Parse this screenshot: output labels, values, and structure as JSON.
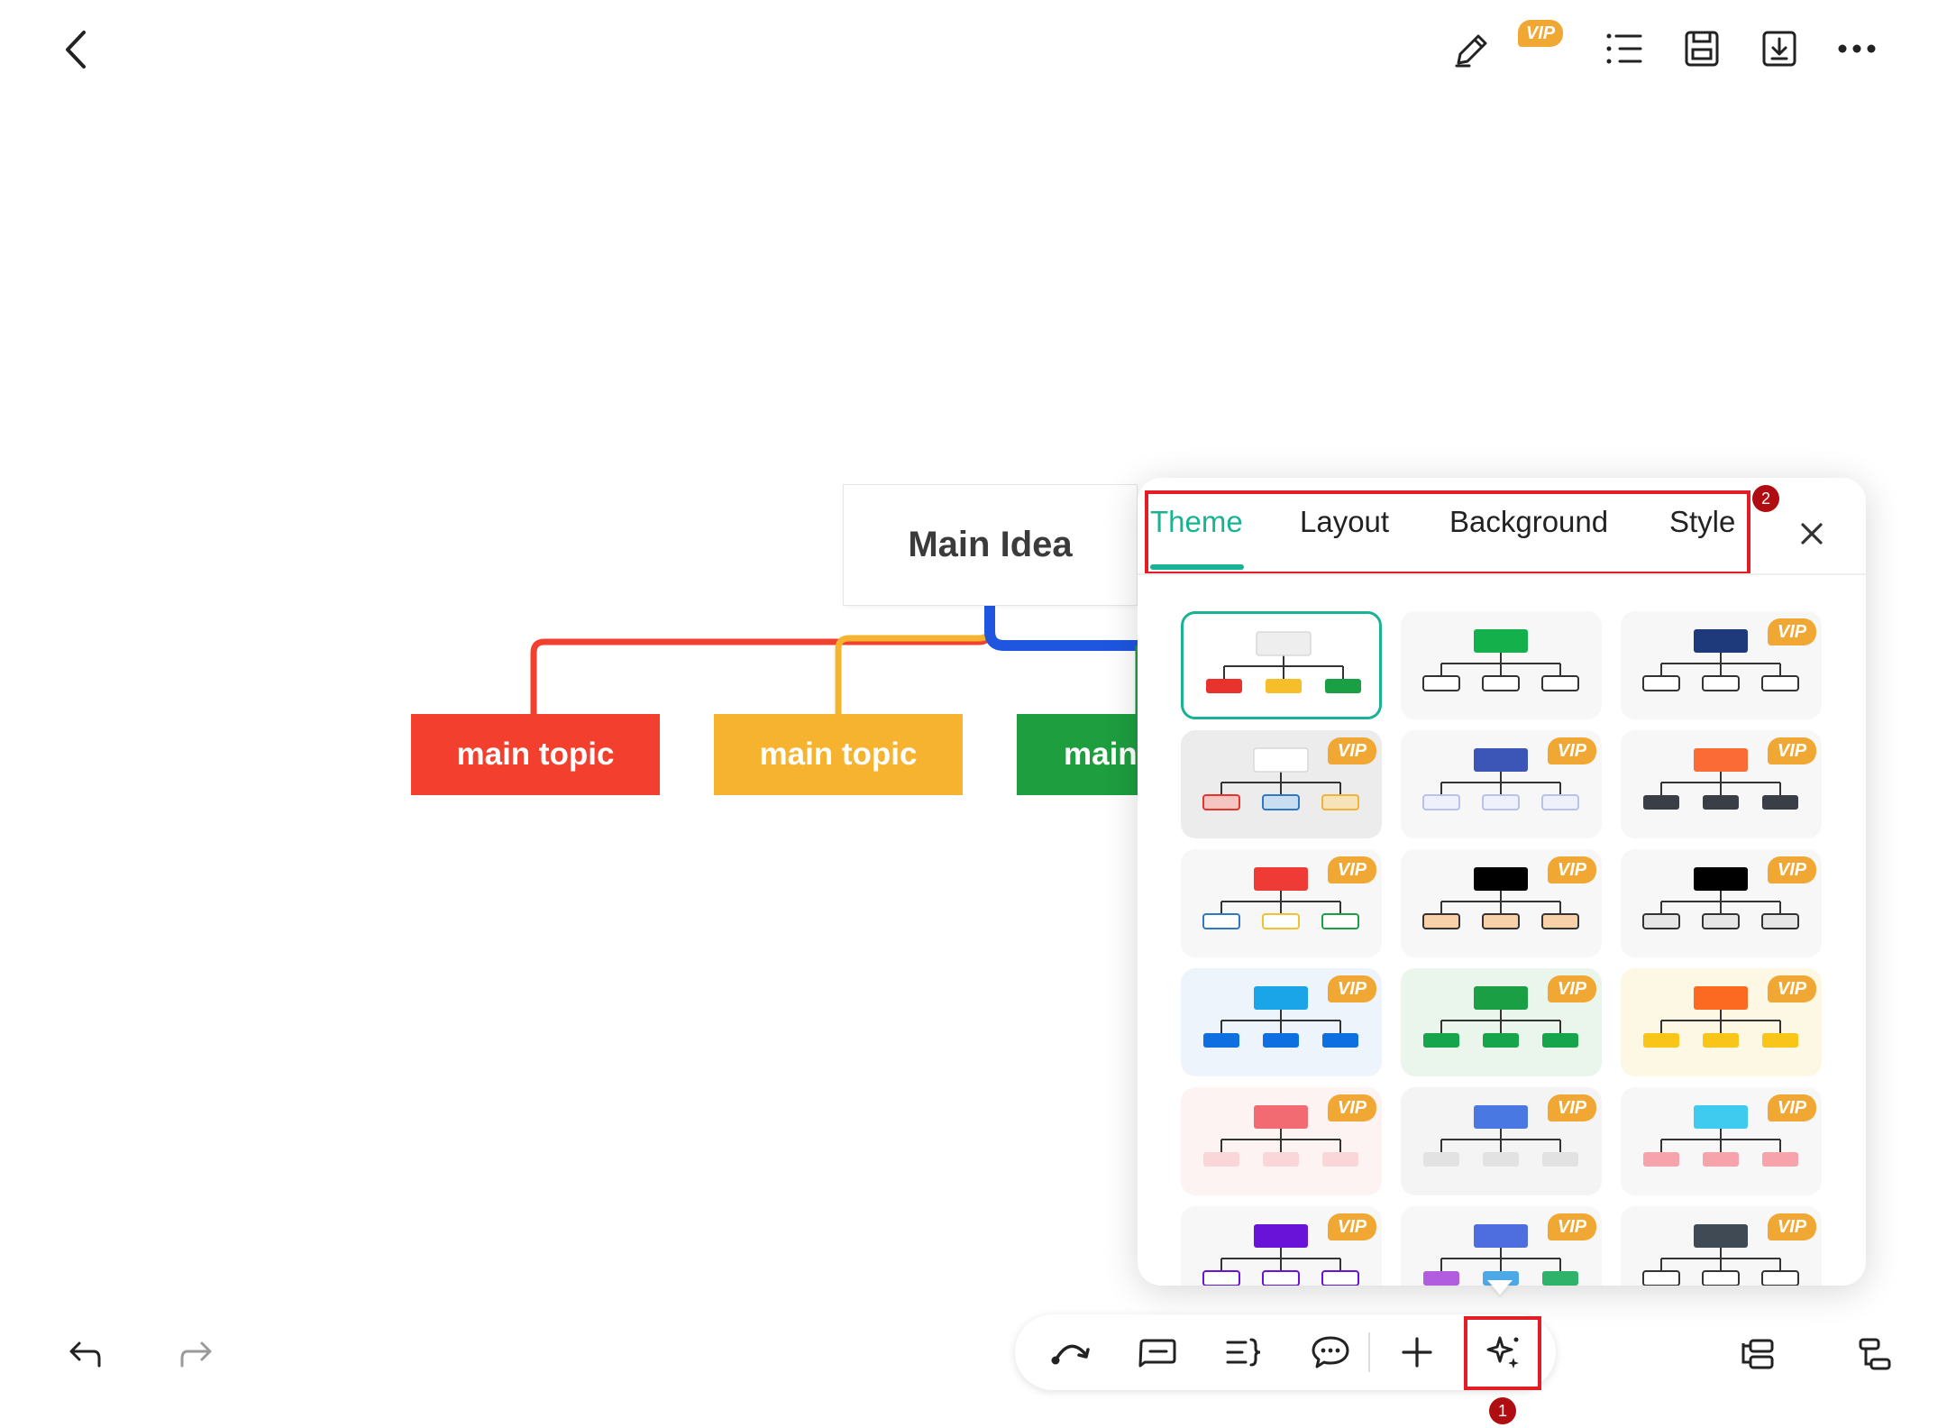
{
  "top_bar": {
    "vip_label": "VIP",
    "icons": [
      "back-icon",
      "pen-icon",
      "outline-list-icon",
      "save-icon",
      "download-icon",
      "more-icon"
    ]
  },
  "canvas": {
    "main_idea": "Main Idea",
    "topics": [
      {
        "label": "main topic",
        "color": "#f33f2e"
      },
      {
        "label": "main topic",
        "color": "#f5b32f"
      },
      {
        "label": "main",
        "color": "#1e9e3f"
      }
    ],
    "connector_colors": [
      "#f33f2e",
      "#f5b32f",
      "#1e56e0"
    ]
  },
  "panel": {
    "tabs": [
      {
        "label": "Theme",
        "active": true
      },
      {
        "label": "Layout",
        "active": false
      },
      {
        "label": "Background",
        "active": false
      },
      {
        "label": "Style",
        "active": false
      }
    ],
    "badge_tabs": "2",
    "accent_color": "#19b394",
    "themes": [
      {
        "vip": false,
        "selected": true,
        "bg": "#ffffff",
        "root": "#eeeeee",
        "children": [
          "#e8332c",
          "#f5be2a",
          "#1a9f45"
        ],
        "child_style": "fill"
      },
      {
        "vip": false,
        "bg": "#f7f7f7",
        "root": "#13b04b",
        "children": [
          "#ffffff",
          "#ffffff",
          "#ffffff"
        ],
        "child_style": "outline-dark"
      },
      {
        "vip": true,
        "bg": "#f7f7f7",
        "root": "#1e3a7a",
        "children": [
          "#ffffff",
          "#ffffff",
          "#ffffff"
        ],
        "child_style": "outline-dark"
      },
      {
        "vip": true,
        "bg": "#ececec",
        "root": "#ffffff",
        "children": [
          "#f5c5c2",
          "#c9def1",
          "#f7e3b8"
        ],
        "child_style": "outline-color",
        "outline": [
          "#e8332c",
          "#2f78c4",
          "#f0b23a"
        ]
      },
      {
        "vip": true,
        "bg": "#f7f7f7",
        "root": "#3c56b8",
        "children": [
          "#eef0fb",
          "#eef0fb",
          "#eef0fb"
        ],
        "child_style": "outline-light"
      },
      {
        "vip": true,
        "bg": "#f7f7f7",
        "root": "#fb6b36",
        "children": [
          "#3a3f47",
          "#3a3f47",
          "#3a3f47"
        ],
        "child_style": "fill"
      },
      {
        "vip": true,
        "bg": "#f7f7f7",
        "root": "#ef3b36",
        "children": [
          "#ffffff",
          "#ffffff",
          "#ffffff"
        ],
        "child_style": "outline-color",
        "outline": [
          "#2f78c4",
          "#f0c231",
          "#1a9f45"
        ]
      },
      {
        "vip": true,
        "bg": "#f7f7f7",
        "root": "#000000",
        "children": [
          "#f8d1a8",
          "#f8d1a8",
          "#f8d1a8"
        ],
        "child_style": "outline-dark"
      },
      {
        "vip": true,
        "bg": "#f7f7f7",
        "root": "#000000",
        "children": [
          "#e6e6e6",
          "#e6e6e6",
          "#e6e6e6"
        ],
        "child_style": "outline-dark"
      },
      {
        "vip": true,
        "bg": "#eef4fb",
        "root": "#1aa5e8",
        "children": [
          "#0d6fe0",
          "#0d6fe0",
          "#0d6fe0"
        ],
        "child_style": "fill"
      },
      {
        "vip": true,
        "bg": "#eaf5ec",
        "root": "#1a9f45",
        "children": [
          "#17a54b",
          "#17a54b",
          "#17a54b"
        ],
        "child_style": "fill"
      },
      {
        "vip": true,
        "bg": "#fcf8e3",
        "root": "#fb6a20",
        "children": [
          "#f8c518",
          "#f8c518",
          "#f8c518"
        ],
        "child_style": "fill"
      },
      {
        "vip": true,
        "bg": "#fdf3f3",
        "root": "#f26b72",
        "children": [
          "#fbd6d8",
          "#fbd6d8",
          "#fbd6d8"
        ],
        "child_style": "fill"
      },
      {
        "vip": true,
        "bg": "#f4f4f4",
        "root": "#4a78e3",
        "children": [
          "#e2e2e2",
          "#e2e2e2",
          "#e2e2e2"
        ],
        "child_style": "fill"
      },
      {
        "vip": true,
        "bg": "#f7f7f7",
        "root": "#3fcbef",
        "children": [
          "#f6a3ac",
          "#f6a3ac",
          "#f6a3ac"
        ],
        "child_style": "fill"
      },
      {
        "vip": true,
        "bg": "#f7f7f7",
        "root": "#6a13d8",
        "children": [
          "#ffffff",
          "#ffffff",
          "#ffffff"
        ],
        "child_style": "outline-color",
        "outline": [
          "#6a13d8",
          "#6a13d8",
          "#6a13d8"
        ]
      },
      {
        "vip": true,
        "bg": "#f7f7f7",
        "root": "#4e6ee0",
        "children": [
          "#b25ddd",
          "#4ea8e8",
          "#2fb36b"
        ],
        "child_style": "fill"
      },
      {
        "vip": true,
        "bg": "#f7f7f7",
        "root": "#3f4a55",
        "children": [
          "#ffffff",
          "#ffffff",
          "#ffffff"
        ],
        "child_style": "outline-dark"
      }
    ]
  },
  "bottom_toolbar": {
    "icons": [
      "relationship-icon",
      "callout-icon",
      "summary-icon",
      "comment-icon",
      "add-topic-icon",
      "theme-magic-icon"
    ],
    "badge_theme": "1"
  },
  "bottom_bar": {
    "icons": [
      "undo-icon",
      "redo-icon",
      "insert-subtopic-icon",
      "insert-floating-icon"
    ]
  }
}
